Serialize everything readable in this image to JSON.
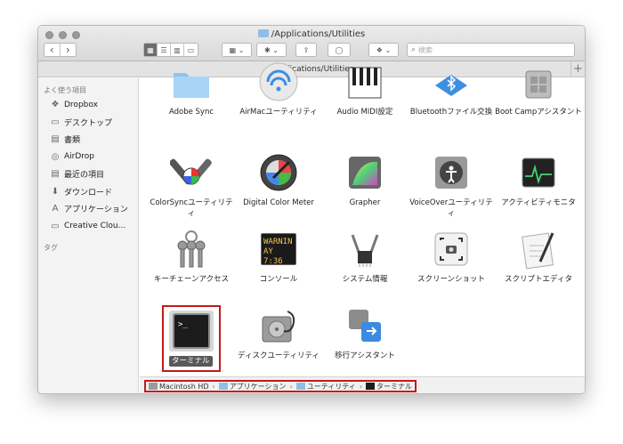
{
  "window": {
    "title": "/Applications/Utilities"
  },
  "toolbar": {
    "back": "‹",
    "forward": "›",
    "view_icons": "▦",
    "view_list": "☰",
    "view_columns": "▥",
    "view_gallery": "▭",
    "arrange": "▦ ⌄",
    "action": "✱ ⌄",
    "share": "⇪",
    "tag": "◯",
    "dropbox": "❖ ⌄",
    "search_placeholder": "検索"
  },
  "pathbar": {
    "path": "/Applications/Utilities",
    "plus": "+"
  },
  "sidebar": {
    "favorites_header": "よく使う項目",
    "items": [
      {
        "label": "Dropbox",
        "icon": "dropbox-icon",
        "glyph": "❖"
      },
      {
        "label": "デスクトップ",
        "icon": "desktop-icon",
        "glyph": "▭"
      },
      {
        "label": "書類",
        "icon": "documents-icon",
        "glyph": "▤"
      },
      {
        "label": "AirDrop",
        "icon": "airdrop-icon",
        "glyph": "◎"
      },
      {
        "label": "最近の項目",
        "icon": "recents-icon",
        "glyph": "▤"
      },
      {
        "label": "ダウンロード",
        "icon": "downloads-icon",
        "glyph": "⬇"
      },
      {
        "label": "アプリケーション",
        "icon": "applications-icon",
        "glyph": "A"
      },
      {
        "label": "Creative Clou...",
        "icon": "folder-icon",
        "glyph": "▭"
      }
    ],
    "tags_header": "タグ"
  },
  "files": [
    {
      "label": "Adobe Sync",
      "icon": "folder-icon"
    },
    {
      "label": "AirMacユーティリティ",
      "icon": "airmac-utility-icon"
    },
    {
      "label": "Audio MIDI設定",
      "icon": "audio-midi-icon"
    },
    {
      "label": "Bluetoothファイル交換",
      "icon": "bluetooth-icon"
    },
    {
      "label": "Boot Campアシスタント",
      "icon": "bootcamp-icon"
    },
    {
      "label": "ColorSyncユーティリティ",
      "icon": "colorsync-icon"
    },
    {
      "label": "Digital Color Meter",
      "icon": "color-meter-icon"
    },
    {
      "label": "Grapher",
      "icon": "grapher-icon"
    },
    {
      "label": "VoiceOverユーティリティ",
      "icon": "voiceover-icon"
    },
    {
      "label": "アクティビティモニタ",
      "icon": "activity-monitor-icon"
    },
    {
      "label": "キーチェーンアクセス",
      "icon": "keychain-icon"
    },
    {
      "label": "コンソール",
      "icon": "console-icon"
    },
    {
      "label": "システム情報",
      "icon": "system-info-icon"
    },
    {
      "label": "スクリーンショット",
      "icon": "screenshot-icon"
    },
    {
      "label": "スクリプトエディタ",
      "icon": "script-editor-icon"
    },
    {
      "label": "ターミナル",
      "icon": "terminal-icon"
    },
    {
      "label": "ディスクユーティリティ",
      "icon": "disk-utility-icon"
    },
    {
      "label": "移行アシスタント",
      "icon": "migration-icon"
    }
  ],
  "console_text": {
    "line1": "WARNIN",
    "line2": "AY 7:36"
  },
  "terminal_prompt": ">_",
  "statusbar": {
    "crumbs": [
      {
        "label": "Macintosh HD",
        "icon": "disk-icon"
      },
      {
        "label": "アプリケーション",
        "icon": "folder-icon"
      },
      {
        "label": "ユーティリティ",
        "icon": "folder-icon"
      },
      {
        "label": "ターミナル",
        "icon": "terminal-icon"
      }
    ],
    "separator": "›"
  },
  "colors": {
    "selection_outline": "#c41a1a",
    "folder_blue": "#8fbfe6"
  }
}
